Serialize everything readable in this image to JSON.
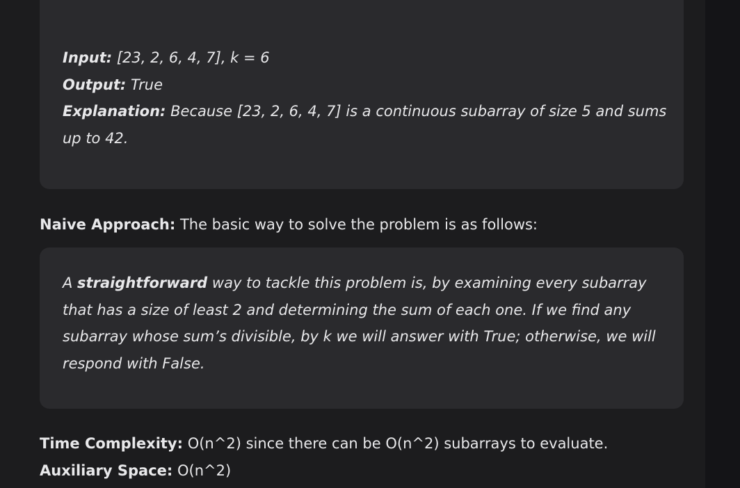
{
  "example": {
    "input_label": "Input:",
    "input_value": " [23, 2, 6, 4, 7], k = 6",
    "output_label": "Output:",
    "output_value": " True",
    "explanation_label": "Explanation:",
    "explanation_line1": " Because [23, 2, 6, 4, 7] is a continuous subarray of size 5 and sums",
    "explanation_line2": "up to 42."
  },
  "naive": {
    "label": "Naive Approach:",
    "text": " The basic way to solve the problem is as follows:",
    "box": {
      "line1_pre": "A ",
      "line1_bold": "straightforward",
      "line1_post": " way to tackle this problem is, by examining every subarray",
      "line2": "that has a size of least 2 and determining the sum of each one. If we find any",
      "line3": "subarray whose sum’s divisible, by k we will answer with True; otherwise, we will",
      "line4": "respond with False."
    }
  },
  "complexity": {
    "time_label": "Time Complexity:",
    "time_value": " O(n^2) since there can be O(n^2) subarrays to evaluate.",
    "aux_label": "Auxiliary Space:",
    "aux_value": " O(n^2)"
  }
}
